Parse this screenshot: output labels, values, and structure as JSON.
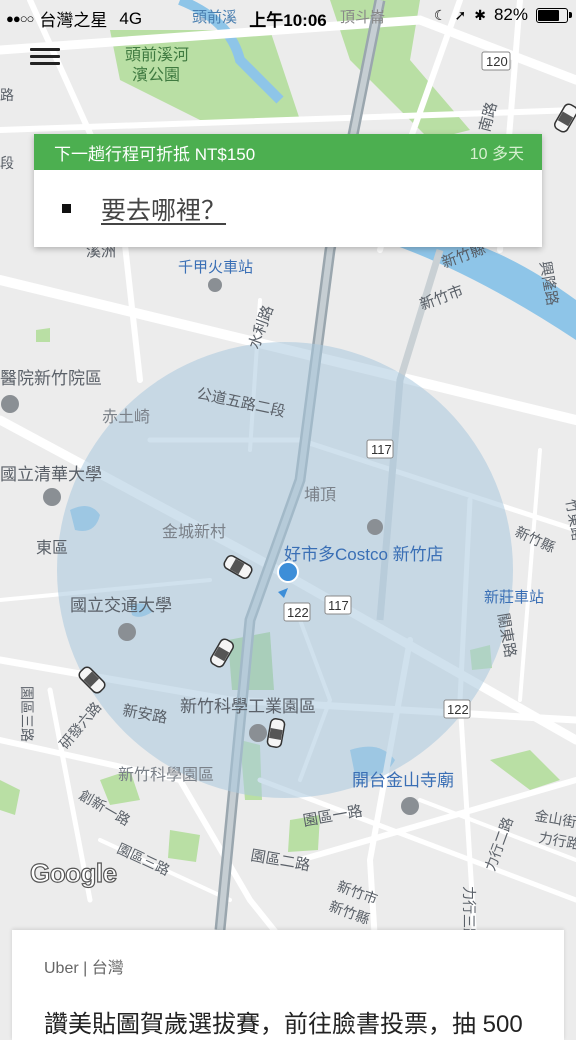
{
  "status_bar": {
    "carrier": "台灣之星",
    "network": "4G",
    "time": "上午10:06",
    "battery": "82%",
    "battery_level": 0.82
  },
  "promo": {
    "text": "下一趟行程可折抵 NT$150",
    "days": "10 多天"
  },
  "where_to": "要去哪裡？",
  "map": {
    "labels": {
      "l1": "頭前溪",
      "l2": "頂斗崙",
      "l3": "頭前溪河",
      "l4": "濱公園",
      "l5": "120",
      "l6": "南路",
      "l7": "溪洲",
      "l8": "千甲火車站",
      "l9": "新竹縣",
      "l10": "新竹市",
      "l11": "興隆路",
      "l12": "水利路",
      "l13": "醫院新竹院區",
      "l14": "公道五路二段",
      "l15": "赤土崎",
      "l16": "117",
      "l17": "國立清華大學",
      "l18": "埔頂",
      "l19": "金城新村",
      "l20": "東區",
      "l21": "好市多Costco 新竹店",
      "l22": "新竹縣",
      "l23": "國立交通大學",
      "l24": "122",
      "l25": "117",
      "l26": "新莊車站",
      "l27": "關東路",
      "l28": "新竹科學工業園區",
      "l29": "122",
      "l30": "新安路",
      "l31": "研發六路",
      "l32": "園區三路",
      "l33": "新竹科學園區",
      "l34": "開台金山寺廟",
      "l35": "創新一路",
      "l36": "園區一路",
      "l37": "園區三路",
      "l38": "園區二路",
      "l39": "金山街",
      "l40": "力行路",
      "l41": "新竹市",
      "l42": "新竹縣",
      "l43": "力行三路",
      "l44": "力行二路",
      "l45": "段",
      "l46": "路",
      "l47": "竹東路"
    },
    "google": "Google"
  },
  "news": {
    "source": "Uber | 台灣",
    "title": "讚美貼圖賀歲選拔賽，前往臉書投票，抽 500"
  }
}
